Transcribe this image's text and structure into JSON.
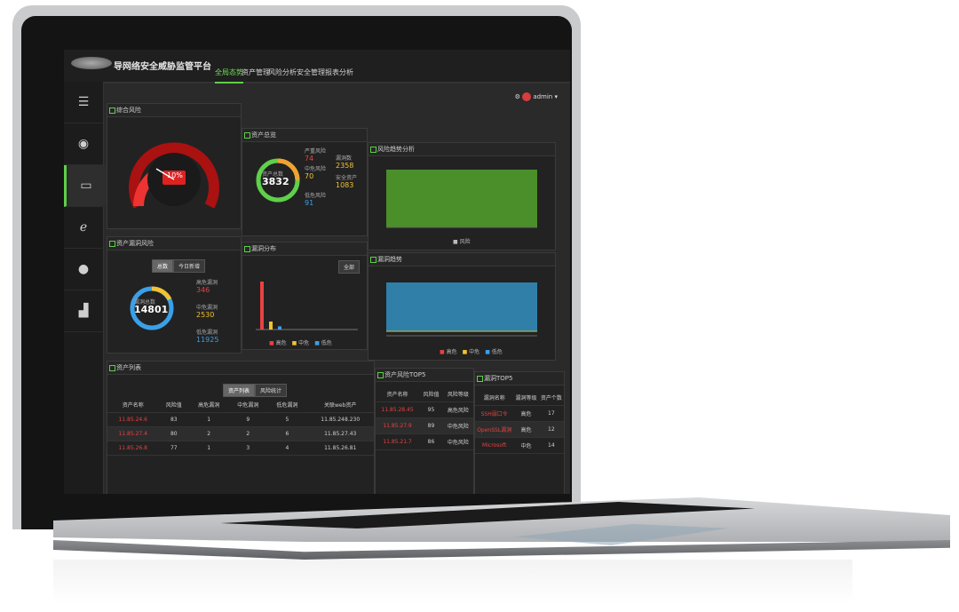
{
  "app": {
    "title": "导网络安全威胁监管平台"
  },
  "tabs": [
    {
      "label": "全局态势",
      "active": true
    },
    {
      "label": "资产管理",
      "active": false
    },
    {
      "label": "风险分析",
      "active": false
    },
    {
      "label": "安全管理",
      "active": false
    },
    {
      "label": "报表分析",
      "active": false
    }
  ],
  "user": {
    "name": "admin"
  },
  "sidebar": {
    "items": [
      "menu-icon",
      "dashboard-icon",
      "monitor-icon",
      "browser-icon",
      "globe-icon",
      "chart-icon"
    ]
  },
  "panels": {
    "gauge": {
      "title": "综合风险",
      "value": "10",
      "unit": "%"
    },
    "assets": {
      "title": "资产总览",
      "total": "3832",
      "total_label": "资产总数",
      "stats": [
        {
          "label": "严重风险",
          "value": "74",
          "color": "#e64242"
        },
        {
          "label": "中危风险",
          "value": "70",
          "color": "#f1c232"
        },
        {
          "label": "低危风险",
          "value": "91",
          "color": "#3aa0e8"
        },
        {
          "label": "漏洞数",
          "value": "2358",
          "color": "#f1c232"
        },
        {
          "label": "安全资产",
          "value": "1083",
          "color": "#f1c232"
        }
      ]
    },
    "trend_top": {
      "title": "风险趋势分析",
      "legend": "风险"
    },
    "vulns": {
      "title": "资产漏洞风险",
      "total": "14801",
      "total_label": "漏洞总数",
      "toggle": [
        "总数",
        "今日新增"
      ],
      "stats": [
        {
          "label": "高危漏洞",
          "value": "346",
          "color": "#e64242"
        },
        {
          "label": "中危漏洞",
          "value": "2530",
          "color": "#f1c232"
        },
        {
          "label": "低危漏洞",
          "value": "11925",
          "color": "#3aa0e8"
        }
      ]
    },
    "dist": {
      "title": "漏洞分布",
      "filter": "全部",
      "legend": [
        "高危",
        "中危",
        "低危"
      ]
    },
    "trend_bottom": {
      "title": "漏洞趋势",
      "legend": [
        "高危",
        "中危",
        "低危"
      ]
    },
    "asset_list": {
      "title": "资产列表",
      "toggle": [
        "资产列表",
        "风险统计"
      ],
      "columns": [
        "资产名称",
        "风险值",
        "高危漏洞",
        "中危漏洞",
        "低危漏洞",
        "关联web资产"
      ],
      "rows": [
        [
          "11.85.24.6",
          "83",
          "1",
          "9",
          "5",
          "11.85.248.230"
        ],
        [
          "11.85.27.4",
          "80",
          "2",
          "2",
          "6",
          "11.85.27.43"
        ],
        [
          "11.85.26.8",
          "77",
          "1",
          "3",
          "4",
          "11.85.26.81"
        ]
      ]
    },
    "top5": {
      "title": "资产风险TOP5",
      "columns": [
        "资产名称",
        "风险值",
        "风险等级"
      ],
      "rows": [
        [
          "11.85.28.45",
          "95",
          "高危风险"
        ],
        [
          "11.85.27.9",
          "89",
          "中危风险"
        ],
        [
          "11.85.21.7",
          "86",
          "中危风险"
        ]
      ]
    },
    "vuln_top": {
      "title": "漏洞TOP5",
      "columns": [
        "漏洞名称",
        "漏洞等级",
        "资产个数"
      ],
      "rows": [
        [
          "SSH弱口令",
          "高危",
          "17"
        ],
        [
          "OpenSSL漏洞",
          "高危",
          "12"
        ],
        [
          "Microsoft",
          "中危",
          "14"
        ]
      ]
    }
  },
  "chart_data": [
    {
      "type": "gauge",
      "value": 10,
      "max": 100,
      "title": "综合风险"
    },
    {
      "type": "area",
      "title": "风险趋势分析",
      "series": [
        {
          "name": "风险",
          "values": [
            90,
            90,
            90,
            90,
            90,
            90
          ]
        }
      ]
    },
    {
      "type": "bar",
      "title": "漏洞分布",
      "categories": [
        "高危",
        "中危",
        "低危"
      ],
      "values": [
        900,
        150,
        60
      ]
    },
    {
      "type": "area",
      "title": "漏洞趋势",
      "series": [
        {
          "name": "低危",
          "values": [
            80,
            82,
            81,
            80,
            82,
            81,
            80,
            82
          ]
        }
      ]
    }
  ]
}
